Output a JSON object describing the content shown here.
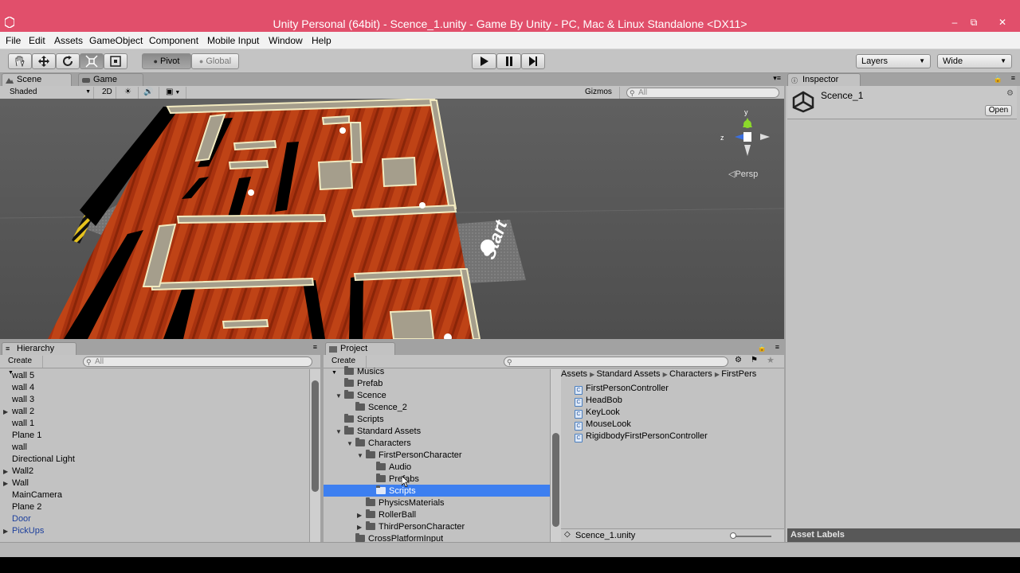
{
  "window": {
    "title": "Unity Personal (64bit) - Scence_1.unity - Game By Unity - PC, Mac & Linux Standalone <DX11>",
    "title_bar_color": "#e14f6b",
    "controls": {
      "minimize": "–",
      "restore": "⧉",
      "close": "✕"
    }
  },
  "menu": [
    "File",
    "Edit",
    "Assets",
    "GameObject",
    "Component",
    "Mobile Input",
    "Window",
    "Help"
  ],
  "toolbar": {
    "tools": [
      "hand-icon",
      "move-icon",
      "rotate-icon",
      "scale-icon",
      "rect-icon"
    ],
    "pivot_label": "Pivot",
    "global_label": "Global",
    "layers_label": "Layers",
    "layout_label": "Wide"
  },
  "scene_panel": {
    "tabs": [
      "Scene",
      "Game"
    ],
    "shading_mode": "Shaded",
    "mode_2d": "2D",
    "gizmos_label": "Gizmos",
    "search_placeholder": "All",
    "persp_label": "◁Persp",
    "axis": {
      "y": "y",
      "z": "z"
    },
    "start_text": "Start"
  },
  "inspector": {
    "tab": "Inspector",
    "object_name": "Scence_1",
    "open_button": "Open",
    "asset_labels": "Asset Labels"
  },
  "hierarchy": {
    "tab": "Hierarchy",
    "create_label": "Create",
    "search_placeholder": "All",
    "items": [
      {
        "name": "wall 5",
        "foldable": false,
        "prefab": false
      },
      {
        "name": "wall 4",
        "foldable": false,
        "prefab": false
      },
      {
        "name": "wall 3",
        "foldable": false,
        "prefab": false
      },
      {
        "name": "wall 2",
        "foldable": true,
        "prefab": false
      },
      {
        "name": "wall 1",
        "foldable": false,
        "prefab": false
      },
      {
        "name": "Plane 1",
        "foldable": false,
        "prefab": false
      },
      {
        "name": "wall",
        "foldable": false,
        "prefab": false
      },
      {
        "name": "Directional Light",
        "foldable": false,
        "prefab": false
      },
      {
        "name": "Wall2",
        "foldable": true,
        "prefab": false
      },
      {
        "name": "Wall",
        "foldable": true,
        "prefab": false
      },
      {
        "name": "MainCamera",
        "foldable": false,
        "prefab": false
      },
      {
        "name": "Plane 2",
        "foldable": false,
        "prefab": false
      },
      {
        "name": "Door",
        "foldable": false,
        "prefab": true
      },
      {
        "name": "PickUps",
        "foldable": true,
        "prefab": true
      }
    ]
  },
  "project": {
    "tab": "Project",
    "create_label": "Create",
    "tree": [
      {
        "name": "Musics",
        "indent": 0,
        "state": "none"
      },
      {
        "name": "Prefab",
        "indent": 0,
        "state": "none"
      },
      {
        "name": "Scence",
        "indent": 0,
        "state": "open"
      },
      {
        "name": "Scence_2",
        "indent": 1,
        "state": "none"
      },
      {
        "name": "Scripts",
        "indent": 0,
        "state": "none"
      },
      {
        "name": "Standard Assets",
        "indent": 0,
        "state": "open"
      },
      {
        "name": "Characters",
        "indent": 1,
        "state": "open"
      },
      {
        "name": "FirstPersonCharacter",
        "indent": 2,
        "state": "open"
      },
      {
        "name": "Audio",
        "indent": 3,
        "state": "none"
      },
      {
        "name": "Prefabs",
        "indent": 3,
        "state": "none"
      },
      {
        "name": "Scripts",
        "indent": 3,
        "state": "selected"
      },
      {
        "name": "PhysicsMaterials",
        "indent": 2,
        "state": "none"
      },
      {
        "name": "RollerBall",
        "indent": 2,
        "state": "closed"
      },
      {
        "name": "ThirdPersonCharacter",
        "indent": 2,
        "state": "closed"
      },
      {
        "name": "CrossPlatformInput",
        "indent": 1,
        "state": "closed"
      }
    ],
    "breadcrumb": [
      "Assets",
      "Standard Assets",
      "Characters",
      "FirstPers"
    ],
    "files": [
      "FirstPersonController",
      "HeadBob",
      "KeyLook",
      "MouseLook",
      "RigidbodyFirstPersonController"
    ],
    "selected_file": "Scence_1.unity",
    "selection_color": "#3d7ff0"
  }
}
